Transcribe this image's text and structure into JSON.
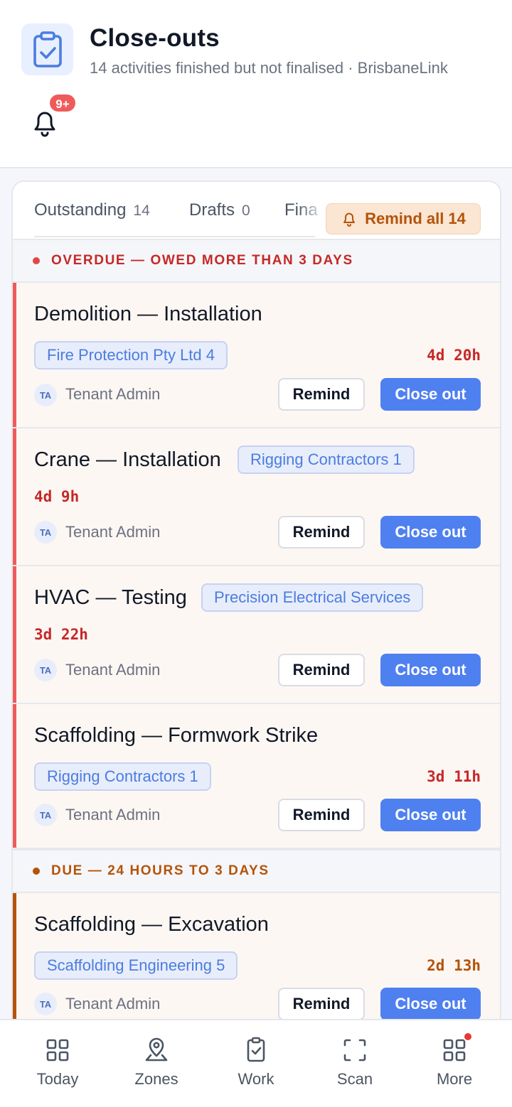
{
  "header": {
    "title": "Close-outs",
    "subtitle": "14 activities finished but not finalised · BrisbaneLink",
    "notifications_badge": "9+"
  },
  "tabs": [
    {
      "label": "Outstanding",
      "count": "14"
    },
    {
      "label": "Drafts",
      "count": "0"
    },
    {
      "label": "Fina",
      "count": ""
    }
  ],
  "remind_all_label": "Remind all 14",
  "sections": {
    "overdue": {
      "label": "OVERDUE — OWED MORE THAN 3 DAYS",
      "color": "#c62828"
    },
    "due": {
      "label": "DUE — 24 HOURS TO 3 DAYS",
      "color": "#b45309"
    }
  },
  "items": [
    {
      "title": "Demolition — Installation",
      "company": "Fire Protection Pty Ltd 4",
      "age": "4d 20h",
      "assignee_initials": "TA",
      "assignee": "Tenant Admin",
      "remind_label": "Remind",
      "close_label": "Close out"
    },
    {
      "title": "Crane — Installation",
      "company": "Rigging Contractors 1",
      "age": "4d 9h",
      "assignee_initials": "TA",
      "assignee": "Tenant Admin",
      "remind_label": "Remind",
      "close_label": "Close out"
    },
    {
      "title": "HVAC — Testing",
      "company": "Precision Electrical Services",
      "age": "3d 22h",
      "assignee_initials": "TA",
      "assignee": "Tenant Admin",
      "remind_label": "Remind",
      "close_label": "Close out"
    },
    {
      "title": "Scaffolding — Formwork Strike",
      "company": "Rigging Contractors 1",
      "age": "3d 11h",
      "assignee_initials": "TA",
      "assignee": "Tenant Admin",
      "remind_label": "Remind",
      "close_label": "Close out"
    },
    {
      "title": "Scaffolding — Excavation",
      "company": "Scaffolding Engineering 5",
      "age": "2d 13h",
      "assignee_initials": "TA",
      "assignee": "Tenant Admin",
      "remind_label": "Remind",
      "close_label": "Close out"
    }
  ],
  "nav": [
    {
      "label": "Today",
      "icon": "grid-icon"
    },
    {
      "label": "Zones",
      "icon": "map-pin-icon"
    },
    {
      "label": "Work",
      "icon": "clipboard-check-icon"
    },
    {
      "label": "Scan",
      "icon": "scan-frame-icon"
    },
    {
      "label": "More",
      "icon": "apps-icon"
    }
  ],
  "colors": {
    "accent_blue": "#4f80f0",
    "overdue_red": "#c62828",
    "overdue_bar": "#ef5b5b",
    "due_orange": "#b45309",
    "chip_blue": "#4a7de0"
  }
}
